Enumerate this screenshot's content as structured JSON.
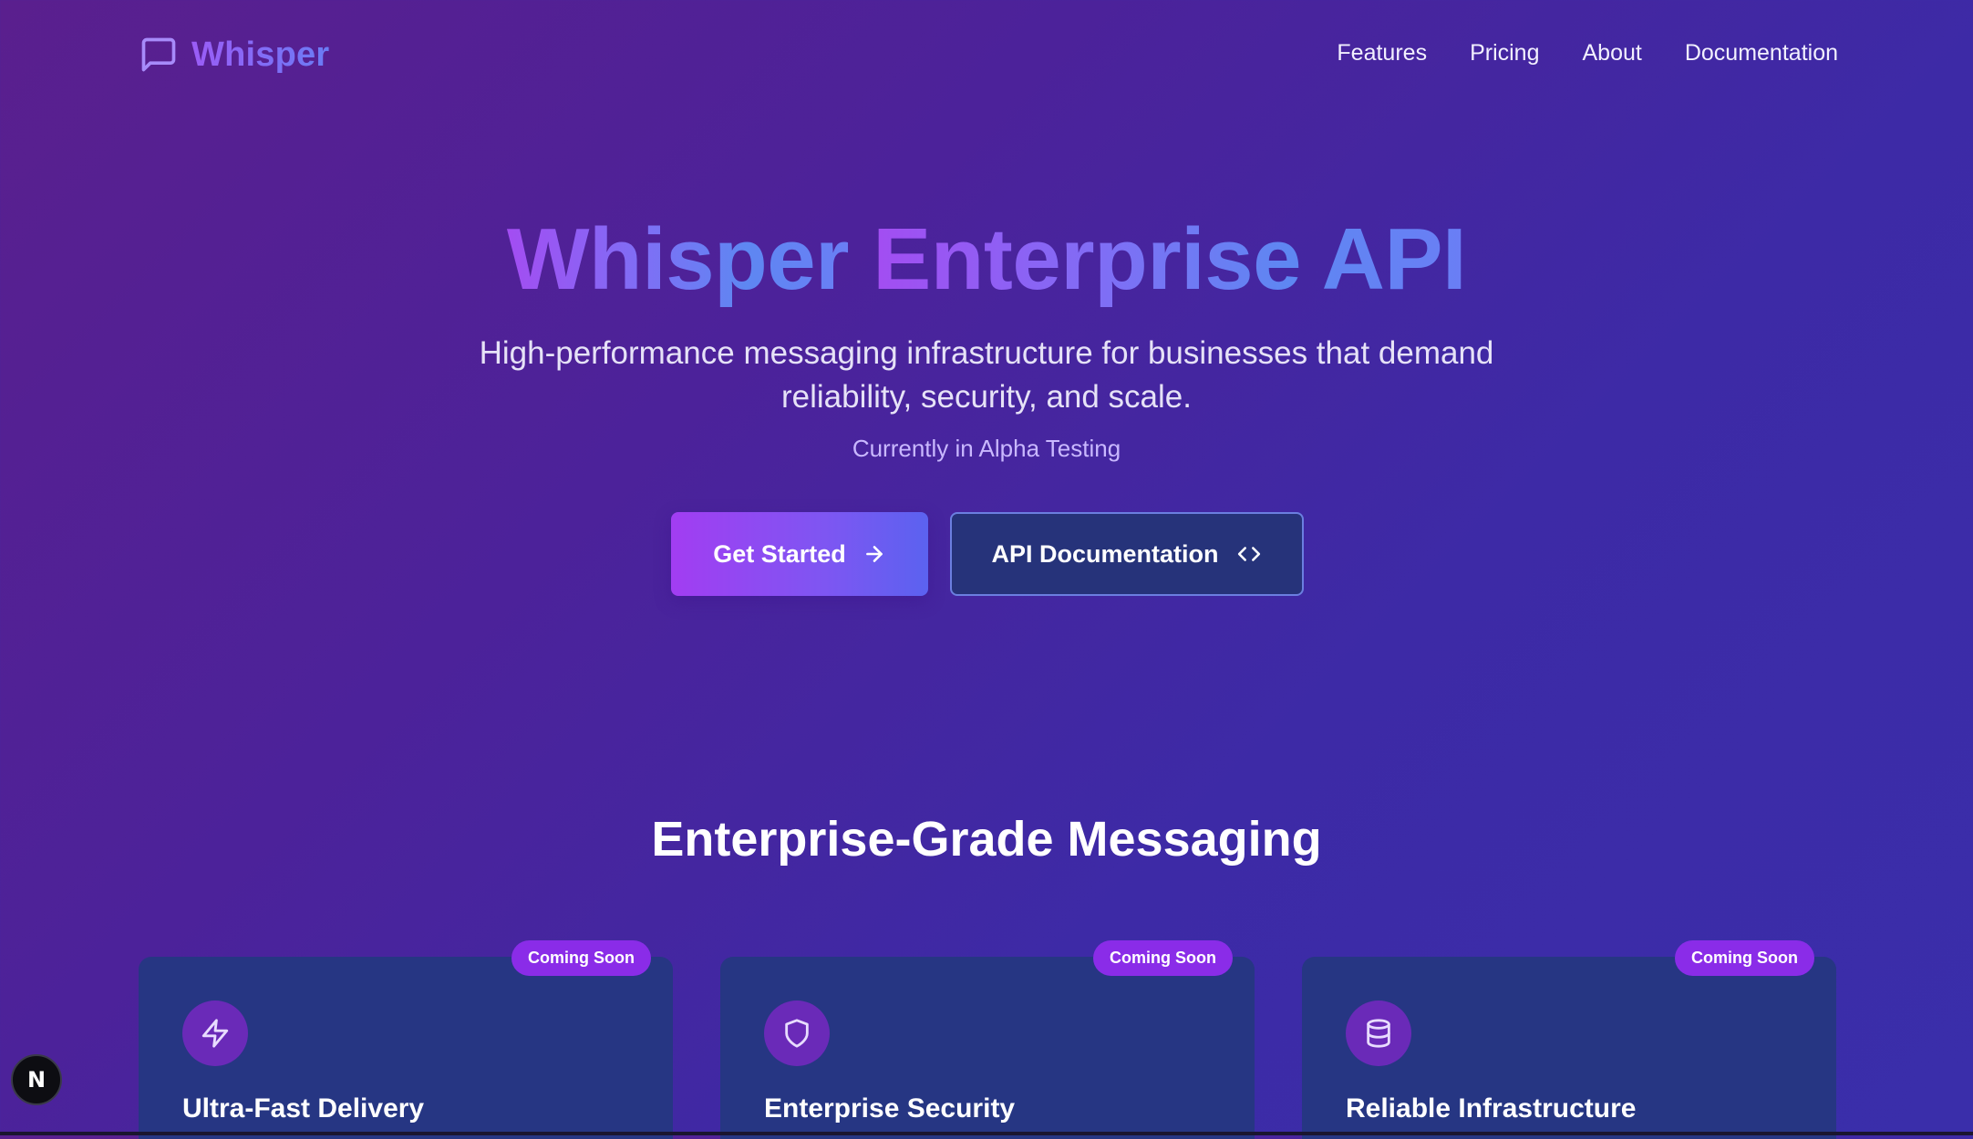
{
  "header": {
    "brand_name": "Whisper",
    "nav": [
      "Features",
      "Pricing",
      "About",
      "Documentation"
    ]
  },
  "hero": {
    "title_part1": "Whisper",
    "title_part2": "Enterprise API",
    "subtitle_line1": "High-performance messaging infrastructure for businesses that demand",
    "subtitle_line2": "reliability, security, and scale.",
    "note": "Currently in Alpha Testing",
    "primary_cta": "Get Started",
    "secondary_cta": "API Documentation"
  },
  "section": {
    "title": "Enterprise-Grade Messaging"
  },
  "cards": [
    {
      "title": "Ultra-Fast Delivery",
      "badge": "Coming Soon",
      "icon": "lightning-icon"
    },
    {
      "title": "Enterprise Security",
      "badge": "Coming Soon",
      "icon": "shield-icon"
    },
    {
      "title": "Reliable Infrastructure",
      "badge": "Coming Soon",
      "icon": "database-icon"
    }
  ],
  "floating_badge": {
    "label": "N"
  },
  "colors": {
    "accent_purple": "#8a2ce8",
    "accent_blue": "#5e87f2",
    "card_bg": "#263683"
  }
}
